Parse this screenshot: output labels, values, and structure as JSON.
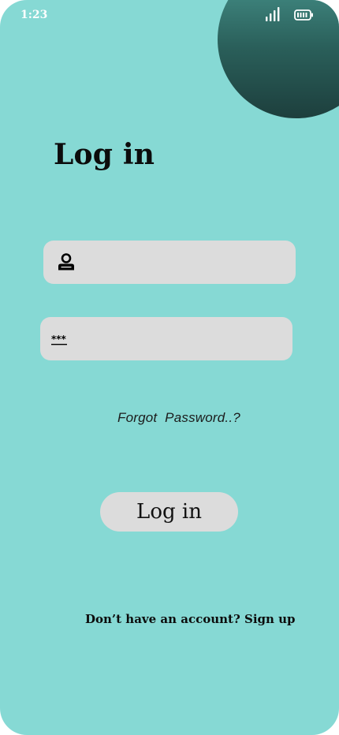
{
  "status_bar": {
    "time": "1:23",
    "signal_icon": "signal-icon",
    "battery_icon": "battery-icon"
  },
  "login": {
    "title": "Log in",
    "username_field": {
      "icon": "user-icon",
      "value": "",
      "placeholder": ""
    },
    "password_field": {
      "icon": "password-icon",
      "icon_text": "***",
      "value": "",
      "placeholder": ""
    },
    "forgot_password_label": "Forgot  Password..?",
    "login_button_label": "Log in",
    "signup_prompt": "Don’t have an account? Sign up"
  },
  "colors": {
    "background": "#86d9d4",
    "accent_circle_top": "#4a9a92",
    "accent_circle_bottom": "#1d3f3d",
    "field_background": "#dcdcdc",
    "text": "#0c0c0c"
  }
}
